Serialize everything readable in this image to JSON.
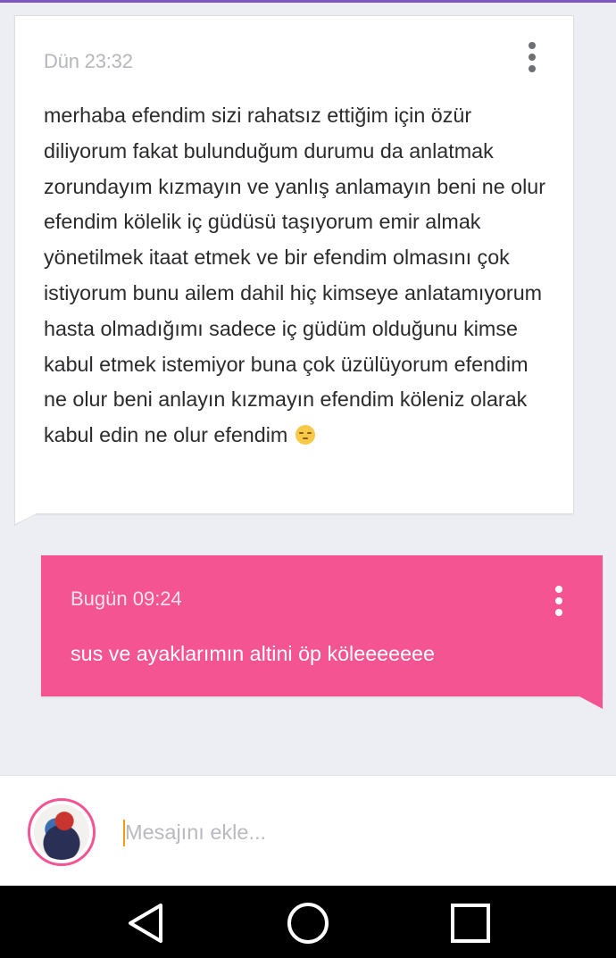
{
  "messages": {
    "incoming": {
      "time": "Dün 23:32",
      "text": "merhaba efendim sizi rahatsız ettiğim için özür diliyorum fakat bulunduğum durumu da anlatmak zorundayım kızmayın ve yanlış anlamayın beni ne olur efendim kölelik iç güdüsü taşıyorum emir almak yönetilmek itaat etmek ve bir efendim olmasını çok istiyorum bunu ailem dahil hiç kimseye anlatamıyorum hasta olmadığımı sadece iç güdüm olduğunu kimse kabul etmek istemiyor buna çok üzülüyorum efendim ne olur beni anlayın kızmayın efendim köleniz olarak kabul edin ne olur efendim",
      "emoji_icon": "unamused-face-emoji",
      "bubble_color": "#ffffff"
    },
    "outgoing": {
      "time": "Bugün 09:24",
      "text": "sus ve ayaklarımın altini öp köleeeeeee",
      "bubble_color": "#f45592"
    }
  },
  "composer": {
    "placeholder": "Mesajını ekle...",
    "value": ""
  },
  "icons": {
    "more": "more-vertical-icon",
    "back": "back-triangle-icon",
    "home": "home-circle-icon",
    "recents": "recents-square-icon"
  },
  "colors": {
    "accent_pink": "#f45592",
    "top_bar": "#7e57c2",
    "caret": "#f39c12"
  }
}
